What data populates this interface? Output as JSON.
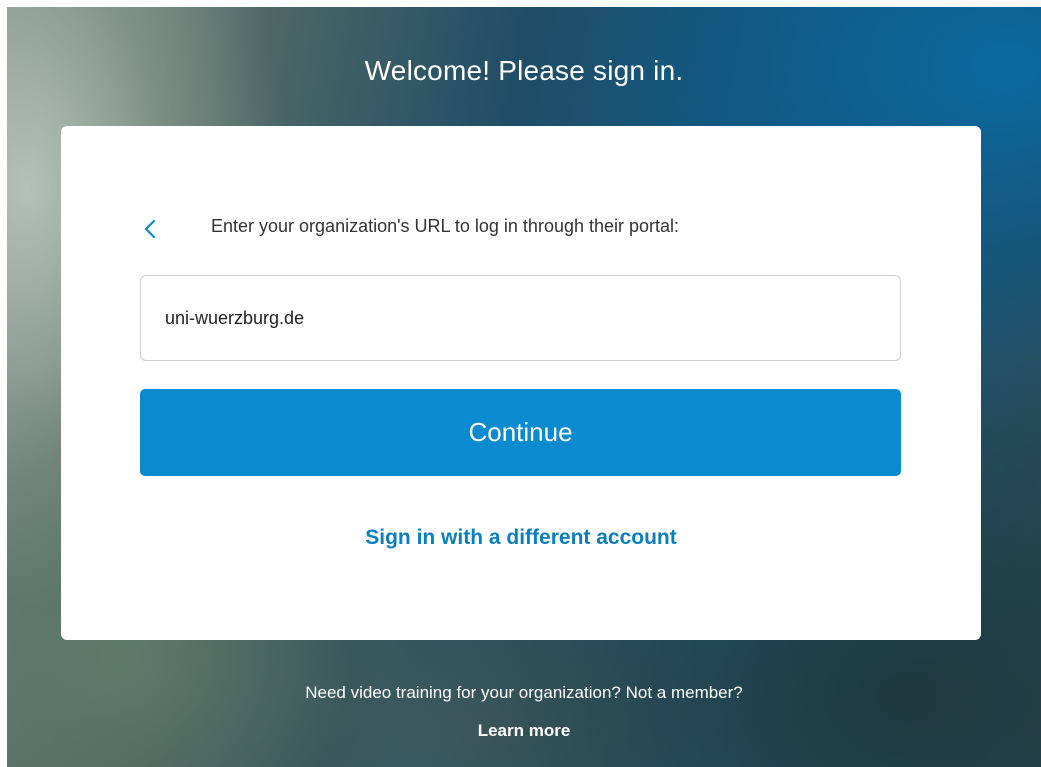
{
  "header": {
    "title": "Welcome! Please sign in."
  },
  "card": {
    "back_icon": "chevron-left-icon",
    "prompt": "Enter your organization's URL to log in through their portal:",
    "url_input": {
      "value": "uni-wuerzburg.de",
      "placeholder": ""
    },
    "continue_label": "Continue",
    "alt_link": "Sign in with a different account"
  },
  "footer": {
    "text": "Need video training for your organization? Not a member?",
    "learn_more": "Learn more"
  },
  "colors": {
    "accent": "#0a8bd0",
    "link": "#0a7fc0",
    "card_bg": "#ffffff"
  }
}
